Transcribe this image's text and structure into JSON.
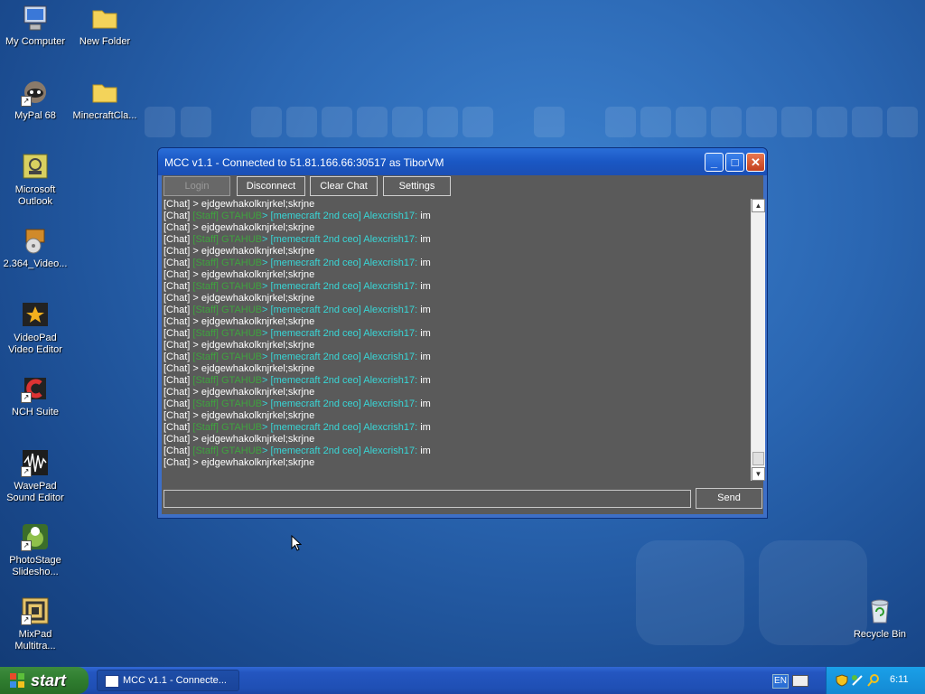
{
  "desktop": {
    "icons": [
      {
        "label": "My Computer",
        "icon": "my-computer-icon"
      },
      {
        "label": "New Folder",
        "icon": "folder-icon"
      },
      {
        "label": "MyPal 68",
        "icon": "mypal-icon"
      },
      {
        "label": "MinecraftCla...",
        "icon": "folder-icon"
      },
      {
        "label": "Microsoft Outlook",
        "icon": "outlook-icon"
      },
      {
        "label": "2.364_Video...",
        "icon": "installer-icon"
      },
      {
        "label": "VideoPad Video Editor",
        "icon": "videopad-icon"
      },
      {
        "label": "NCH Suite",
        "icon": "nch-icon"
      },
      {
        "label": "WavePad Sound Editor",
        "icon": "wavepad-icon"
      },
      {
        "label": "PhotoStage Slidesho...",
        "icon": "photostage-icon"
      },
      {
        "label": "MixPad Multitra...",
        "icon": "mixpad-icon"
      },
      {
        "label": "Recycle Bin",
        "icon": "recycle-bin-icon"
      }
    ]
  },
  "window": {
    "title": "MCC v1.1 - Connected to 51.81.166.66:30517 as TiborVM",
    "buttons": {
      "login": "Login",
      "disconnect": "Disconnect",
      "clear_chat": "Clear Chat",
      "settings": "Settings"
    },
    "chat_lines": [
      {
        "prefix": "[Chat] > ",
        "rank": "",
        "tag": "",
        "text": "ejdgewhakolknjrkel;skrjne"
      },
      {
        "prefix": "[Chat] ",
        "rank": "[Staff] GTAHUB",
        "tag": "> [memecraft 2nd ceo] Alexcrish17:",
        "text": " im"
      },
      {
        "prefix": "[Chat] > ",
        "rank": "",
        "tag": "",
        "text": "ejdgewhakolknjrkel;skrjne"
      },
      {
        "prefix": "[Chat] ",
        "rank": "[Staff] GTAHUB",
        "tag": "> [memecraft 2nd ceo] Alexcrish17:",
        "text": " im"
      },
      {
        "prefix": "[Chat] > ",
        "rank": "",
        "tag": "",
        "text": "ejdgewhakolknjrkel;skrjne"
      },
      {
        "prefix": "[Chat] ",
        "rank": "[Staff] GTAHUB",
        "tag": "> [memecraft 2nd ceo] Alexcrish17:",
        "text": " im"
      },
      {
        "prefix": "[Chat] > ",
        "rank": "",
        "tag": "",
        "text": "ejdgewhakolknjrkel;skrjne"
      },
      {
        "prefix": "[Chat] ",
        "rank": "[Staff] GTAHUB",
        "tag": "> [memecraft 2nd ceo] Alexcrish17:",
        "text": " im"
      },
      {
        "prefix": "[Chat] > ",
        "rank": "",
        "tag": "",
        "text": "ejdgewhakolknjrkel;skrjne"
      },
      {
        "prefix": "[Chat] ",
        "rank": "[Staff] GTAHUB",
        "tag": "> [memecraft 2nd ceo] Alexcrish17:",
        "text": " im"
      },
      {
        "prefix": "[Chat] > ",
        "rank": "",
        "tag": "",
        "text": "ejdgewhakolknjrkel;skrjne"
      },
      {
        "prefix": "[Chat] ",
        "rank": "[Staff] GTAHUB",
        "tag": "> [memecraft 2nd ceo] Alexcrish17:",
        "text": " im"
      },
      {
        "prefix": "[Chat] > ",
        "rank": "",
        "tag": "",
        "text": "ejdgewhakolknjrkel;skrjne"
      },
      {
        "prefix": "[Chat] ",
        "rank": "[Staff] GTAHUB",
        "tag": "> [memecraft 2nd ceo] Alexcrish17:",
        "text": " im"
      },
      {
        "prefix": "[Chat] > ",
        "rank": "",
        "tag": "",
        "text": "ejdgewhakolknjrkel;skrjne"
      },
      {
        "prefix": "[Chat] ",
        "rank": "[Staff] GTAHUB",
        "tag": "> [memecraft 2nd ceo] Alexcrish17:",
        "text": " im"
      },
      {
        "prefix": "[Chat] > ",
        "rank": "",
        "tag": "",
        "text": "ejdgewhakolknjrkel;skrjne"
      },
      {
        "prefix": "[Chat] ",
        "rank": "[Staff] GTAHUB",
        "tag": "> [memecraft 2nd ceo] Alexcrish17:",
        "text": " im"
      },
      {
        "prefix": "[Chat] > ",
        "rank": "",
        "tag": "",
        "text": "ejdgewhakolknjrkel;skrjne"
      },
      {
        "prefix": "[Chat] ",
        "rank": "[Staff] GTAHUB",
        "tag": "> [memecraft 2nd ceo] Alexcrish17:",
        "text": " im"
      },
      {
        "prefix": "[Chat] > ",
        "rank": "",
        "tag": "",
        "text": "ejdgewhakolknjrkel;skrjne"
      },
      {
        "prefix": "[Chat] ",
        "rank": "[Staff] GTAHUB",
        "tag": "> [memecraft 2nd ceo] Alexcrish17:",
        "text": " im"
      },
      {
        "prefix": "[Chat] > ",
        "rank": "",
        "tag": "",
        "text": "ejdgewhakolknjrkel;skrjne"
      }
    ],
    "message_input": {
      "value": "",
      "placeholder": ""
    },
    "send_label": "Send"
  },
  "taskbar": {
    "start_label": "start",
    "task_label": "MCC v1.1 - Connecte...",
    "language": "EN",
    "clock": "6:11"
  },
  "colors": {
    "rank_green": "#3fa33f",
    "tag_cyan": "#38d6d6",
    "client_bg": "#5a5a5a",
    "titlebar_blue": "#1a57c4"
  }
}
